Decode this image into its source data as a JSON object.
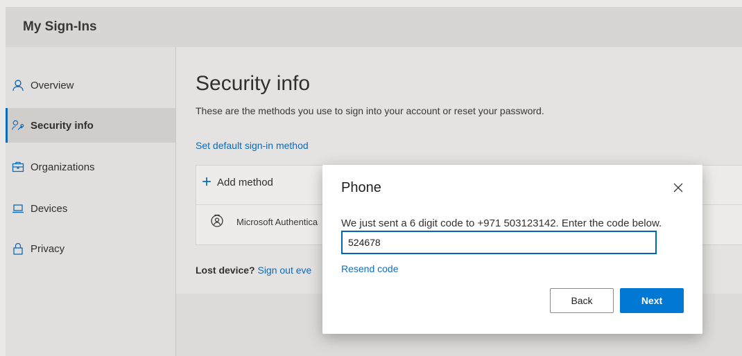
{
  "header": {
    "title": "My Sign-Ins"
  },
  "sidebar": {
    "items": [
      {
        "label": "Overview",
        "icon": "person-icon",
        "active": false
      },
      {
        "label": "Security info",
        "icon": "person-key-icon",
        "active": true
      },
      {
        "label": "Organizations",
        "icon": "briefcase-icon",
        "active": false
      },
      {
        "label": "Devices",
        "icon": "laptop-icon",
        "active": false
      },
      {
        "label": "Privacy",
        "icon": "lock-icon",
        "active": false
      }
    ]
  },
  "main": {
    "title": "Security info",
    "subtitle": "These are the methods you use to sign into your account or reset your password.",
    "set_default_link": "Set default sign-in method",
    "add_method_label": "Add method",
    "methods": [
      {
        "label": "Microsoft Authentica",
        "icon": "authenticator-icon"
      }
    ],
    "lost_device_label": "Lost device?",
    "sign_out_link": "Sign out eve"
  },
  "dialog": {
    "title": "Phone",
    "message": "We just sent a 6 digit code to +971 503123142. Enter the code below.",
    "code_value": "524678",
    "resend_link": "Resend code",
    "back_label": "Back",
    "next_label": "Next"
  },
  "colors": {
    "accent": "#0078d4",
    "link": "#106ebe",
    "input_border": "#0067b8"
  }
}
